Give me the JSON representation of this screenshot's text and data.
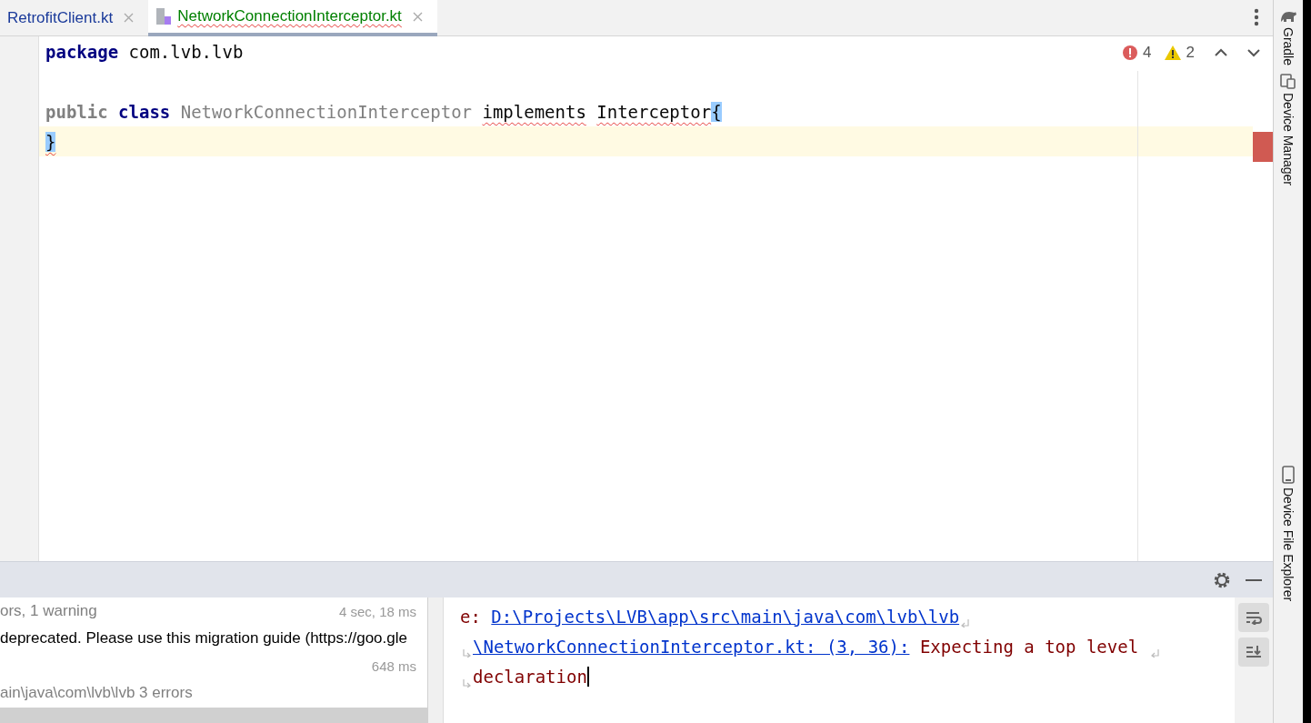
{
  "tabs": [
    {
      "label": "RetrofitClient.kt",
      "selected": false,
      "error": false
    },
    {
      "label": "NetworkConnectionInterceptor.kt",
      "selected": true,
      "error": true
    }
  ],
  "inspections": {
    "errors": "4",
    "warnings": "2"
  },
  "code": {
    "lines": [
      {
        "kind": "code",
        "current": false,
        "tokens": [
          {
            "text": "package",
            "kind": "keyword"
          },
          {
            "text": "com.lvb.lvb",
            "kind": "plain",
            "space_before": true
          }
        ]
      },
      {
        "kind": "blank"
      },
      {
        "kind": "code",
        "current": false,
        "tokens": [
          {
            "text": "public",
            "kind": "unused"
          },
          {
            "text": "class",
            "kind": "keyword",
            "space_before": true
          },
          {
            "text": "NetworkConnectionInterceptor",
            "kind": "unused",
            "space_before": true
          },
          {
            "text": "implements",
            "kind": "plain",
            "error": true,
            "space_before": true
          },
          {
            "text": "Interceptor",
            "kind": "plain",
            "error": true,
            "space_before": true
          },
          {
            "text": "{",
            "kind": "plain",
            "matched": true
          }
        ]
      },
      {
        "kind": "code",
        "current": true,
        "tokens": [
          {
            "text": "}",
            "kind": "plain",
            "matched": true,
            "error": true
          }
        ]
      }
    ]
  },
  "right_sidebar": [
    {
      "label": "Gradle",
      "kind": "gradle"
    },
    {
      "label": "Device Manager",
      "kind": "device"
    },
    {
      "label": "Device File Explorer",
      "kind": "phone"
    }
  ],
  "build_tree": [
    {
      "text": "ors, 1 warning",
      "time": "4 sec, 18 ms",
      "kind": "summary"
    },
    {
      "text": "deprecated. Please use this migration guide (https://goo.gle",
      "kind": "message"
    },
    {
      "time": "648 ms",
      "kind": "summary"
    },
    {
      "text": "ain\\java\\com\\lvb\\lvb 3 errors",
      "kind": "summary"
    }
  ],
  "console": {
    "lines": [
      {
        "wrap_start": false,
        "wrap_end": true,
        "parts": [
          {
            "text": "e: ",
            "kind": "error"
          },
          {
            "text": "D:\\Projects\\LVB\\app\\src\\main\\java\\com\\lvb\\lvb",
            "kind": "link"
          }
        ]
      },
      {
        "wrap_start": true,
        "wrap_end": true,
        "parts": [
          {
            "text": "\\NetworkConnectionInterceptor.kt: (3, 36):",
            "kind": "link"
          },
          {
            "text": " Expecting a top level ",
            "kind": "error"
          }
        ]
      },
      {
        "wrap_start": true,
        "wrap_end": false,
        "caret": true,
        "parts": [
          {
            "text": "declaration",
            "kind": "error"
          }
        ]
      }
    ]
  }
}
